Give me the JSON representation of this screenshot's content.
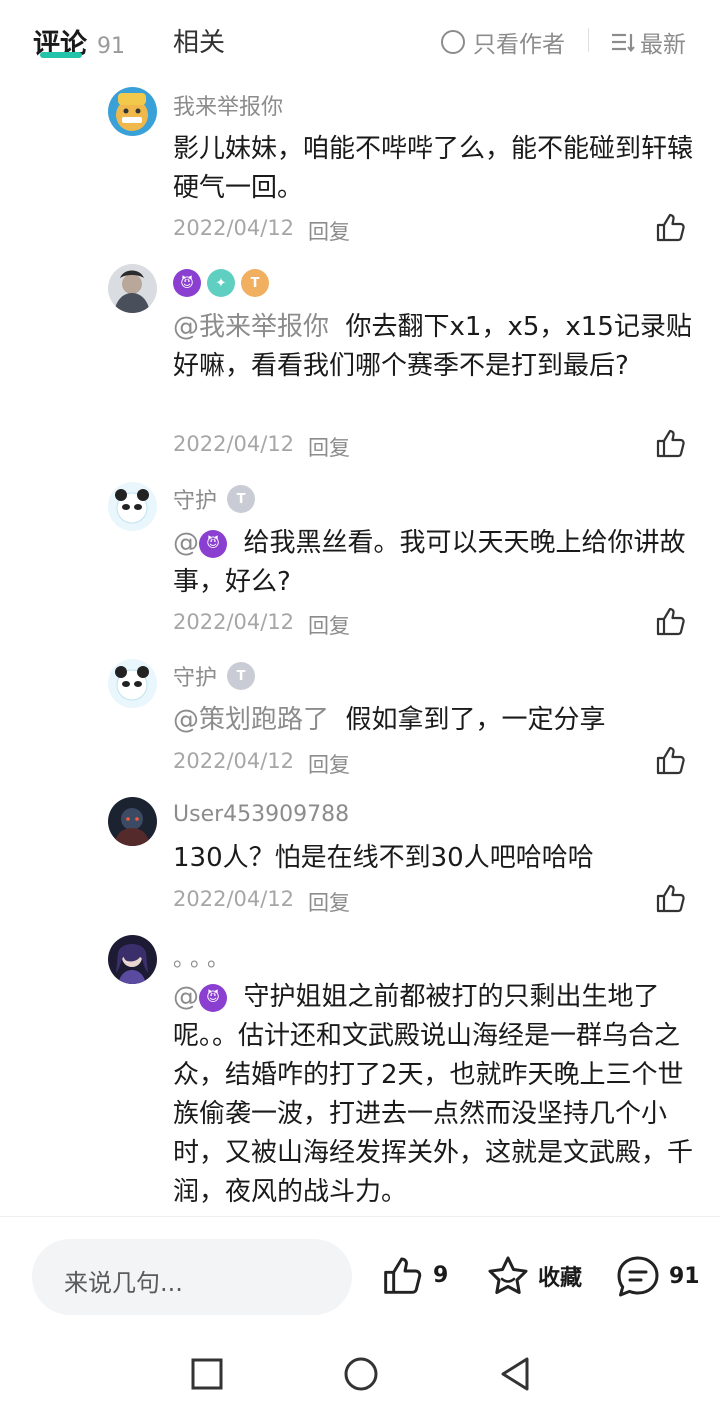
{
  "tabs": {
    "comments_label": "评论",
    "comments_count": "91",
    "related_label": "相关",
    "author_only": "只看作者",
    "sort": "最新"
  },
  "comments": [
    {
      "username": "我来举报你",
      "text": "影儿妹妹，咱能不哔哔了么，能不能碰到轩辕硬气一回。",
      "date": "2022/04/12",
      "reply": "回复"
    },
    {
      "username": "",
      "mention": "@我来举报你",
      "text": "你去翻下x1，x5，x15记录贴好嘛，看看我们哪个赛季不是打到最后?",
      "date": "2022/04/12",
      "reply": "回复"
    },
    {
      "username": "守护",
      "mention": "@",
      "text": "给我黑丝看。我可以天天晚上给你讲故事，好么?",
      "date": "2022/04/12",
      "reply": "回复"
    },
    {
      "username": "守护",
      "mention": "@策划跑路了",
      "text": "假如拿到了，一定分享",
      "date": "2022/04/12",
      "reply": "回复"
    },
    {
      "username": "User453909788",
      "text": "130人？怕是在线不到30人吧哈哈哈",
      "date": "2022/04/12",
      "reply": "回复"
    },
    {
      "username": "。。。",
      "mention": "@",
      "text": "守护姐姐之前都被打的只剩出生地了呢。。估计还和文武殿说山海经是一群乌合之众，结婚咋的打了2天，也就昨天晚上三个世族偷袭一波，打进去一点然而没坚持几个小时，又被山海经发挥关外，这就是文武殿，千润，夜风的战斗力。"
    }
  ],
  "bottom": {
    "placeholder": "来说几句...",
    "likes": "9",
    "favorite": "收藏",
    "comments": "91"
  }
}
